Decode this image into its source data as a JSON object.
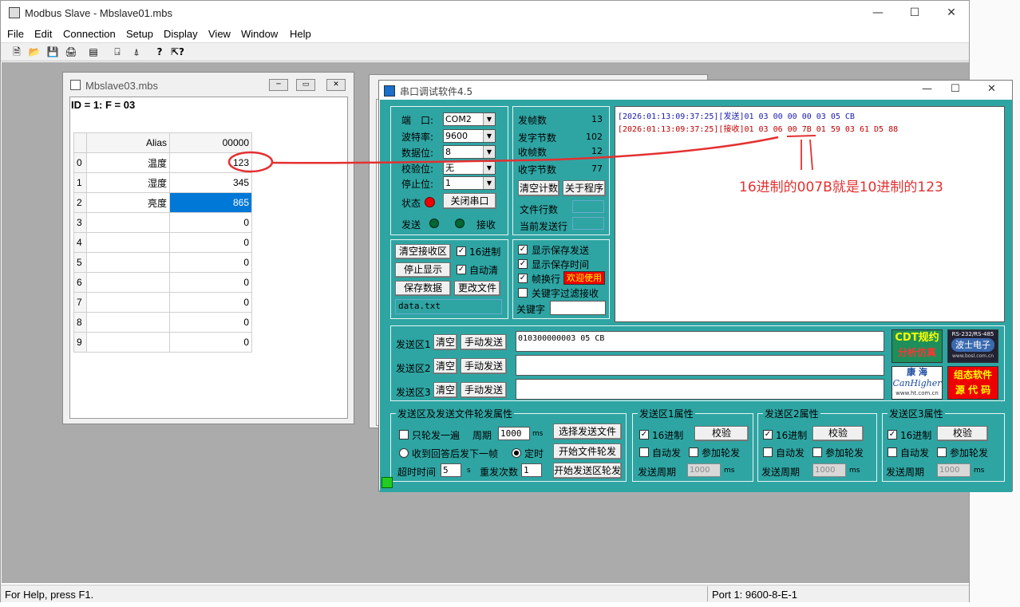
{
  "main": {
    "title": "Modbus Slave - Mbslave01.mbs",
    "menus": [
      "File",
      "Edit",
      "Connection",
      "Setup",
      "Display",
      "View",
      "Window",
      "Help"
    ],
    "status_left": "For Help, press F1.",
    "status_right": "Port 1: 9600-8-E-1"
  },
  "child1": {
    "title": "Mbslave03.mbs",
    "header": "ID = 1: F = 03",
    "col_alias": "Alias",
    "col_addr": "00000",
    "rows": [
      {
        "idx": "0",
        "alias": "温度",
        "value": "123"
      },
      {
        "idx": "1",
        "alias": "湿度",
        "value": "345"
      },
      {
        "idx": "2",
        "alias": "亮度",
        "value": "865"
      },
      {
        "idx": "3",
        "alias": "",
        "value": "0"
      },
      {
        "idx": "4",
        "alias": "",
        "value": "0"
      },
      {
        "idx": "5",
        "alias": "",
        "value": "0"
      },
      {
        "idx": "6",
        "alias": "",
        "value": "0"
      },
      {
        "idx": "7",
        "alias": "",
        "value": "0"
      },
      {
        "idx": "8",
        "alias": "",
        "value": "0"
      },
      {
        "idx": "9",
        "alias": "",
        "value": "0"
      }
    ]
  },
  "serial": {
    "title": "串口调试软件4.5",
    "port_label": "端　口:",
    "port_value": "COM2",
    "baud_label": "波特率:",
    "baud_value": "9600",
    "data_label": "数据位:",
    "data_value": "8",
    "parity_label": "校验位:",
    "parity_value": "无",
    "stop_label": "停止位:",
    "stop_value": "1",
    "state_label": "状态",
    "close_port": "关闭串口",
    "send_label": "发送",
    "recv_label": "接收",
    "stats": [
      {
        "label": "发帧数",
        "value": "13"
      },
      {
        "label": "发字节数",
        "value": "102"
      },
      {
        "label": "收帧数",
        "value": "12"
      },
      {
        "label": "收字节数",
        "value": "77"
      }
    ],
    "clear_count": "清空计数",
    "about": "关于程序",
    "file_rows": "文件行数",
    "cur_send_row": "当前发送行",
    "clear_recv": "清空接收区",
    "hex16": "16进制",
    "stop_disp": "停止显示",
    "auto_clear": "自动清",
    "save_data": "保存数据",
    "change_file": "更改文件",
    "filename": "data.txt",
    "show_send": "显示保存发送",
    "show_time": "显示保存时间",
    "frame_wrap": "帧换行",
    "welcome": "欢迎使用",
    "keyword_filter": "关键字过滤接收",
    "keyword": "关键字",
    "log_send": "[2026:01:13:09:37:25][发送]01 03 00 00 00 03 05 CB",
    "log_recv": "[2026:01:13:09:37:25][接收]01 03 06 00 7B 01 59 03 61 D5 88",
    "send1": "发送区1",
    "send2": "发送区2",
    "send3": "发送区3",
    "clear": "清空",
    "manual_send": "手动发送",
    "send1_text": "010300000003 05 CB",
    "ad1_top": "CDT规约",
    "ad1_bot": "分析仿真",
    "ad2_top": "RS-232/RS-485",
    "ad2_mid": "波士电子",
    "ad2_bot": "www.bosl.com.cn",
    "ad3_top": "康 海",
    "ad3_mid": "CanHigher",
    "ad3_bot": "www.ht.com.cn",
    "ad4_top": "组态软件",
    "ad4_bot": "源 代 码",
    "poll_title": "发送区及发送文件轮发属性",
    "only_once": "只轮发一遍",
    "period": "周期",
    "period_val": "1000",
    "ms": "ms",
    "select_file": "选择发送文件",
    "after_reply": "收到回答后发下一帧",
    "timed": "定时",
    "start_file": "开始文件轮发",
    "timeout": "超时时间",
    "timeout_val": "5",
    "s": "s",
    "resend": "重发次数",
    "resend_val": "1",
    "start_area": "开始发送区轮发",
    "area1_title": "发送区1属性",
    "area2_title": "发送区2属性",
    "area3_title": "发送区3属性",
    "verify": "校验",
    "auto_send": "自动发",
    "join_poll": "参加轮发",
    "send_period": "发送周期",
    "period_default": "1000"
  },
  "annotation": "16进制的007B就是10进制的123"
}
